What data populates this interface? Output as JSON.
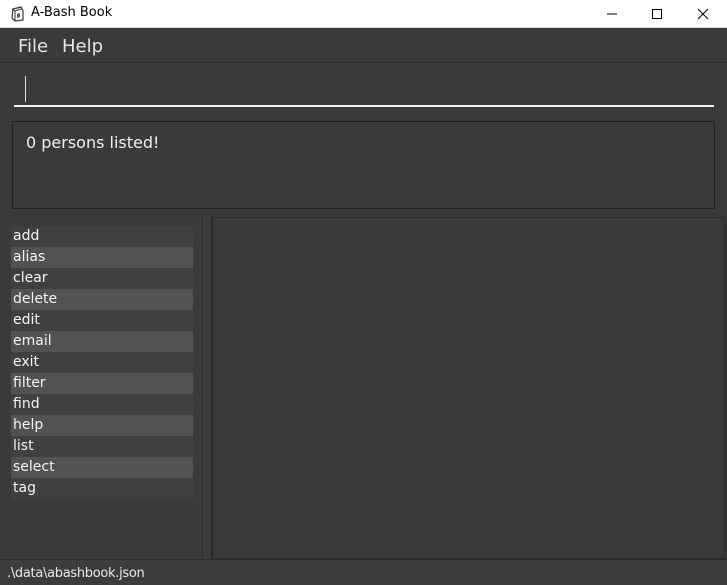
{
  "window": {
    "title": "A-Bash Book"
  },
  "menu": {
    "file_label": "File",
    "help_label": "Help"
  },
  "command_box": {
    "value": "",
    "placeholder": ""
  },
  "result_display": {
    "message": "0 persons listed!"
  },
  "command_list": {
    "items": [
      "add",
      "alias",
      "clear",
      "delete",
      "edit",
      "email",
      "exit",
      "filter",
      "find",
      "help",
      "list",
      "select",
      "tag"
    ]
  },
  "status_bar": {
    "file_path": ".\\data\\abashbook.json"
  },
  "colors": {
    "background": "#3a3a3a",
    "row_odd": "#404040",
    "row_even": "#525252",
    "text": "#f4f4f4"
  },
  "icons": {
    "app": "app-icon",
    "minimize": "minimize-icon",
    "maximize": "maximize-icon",
    "close": "close-icon"
  }
}
